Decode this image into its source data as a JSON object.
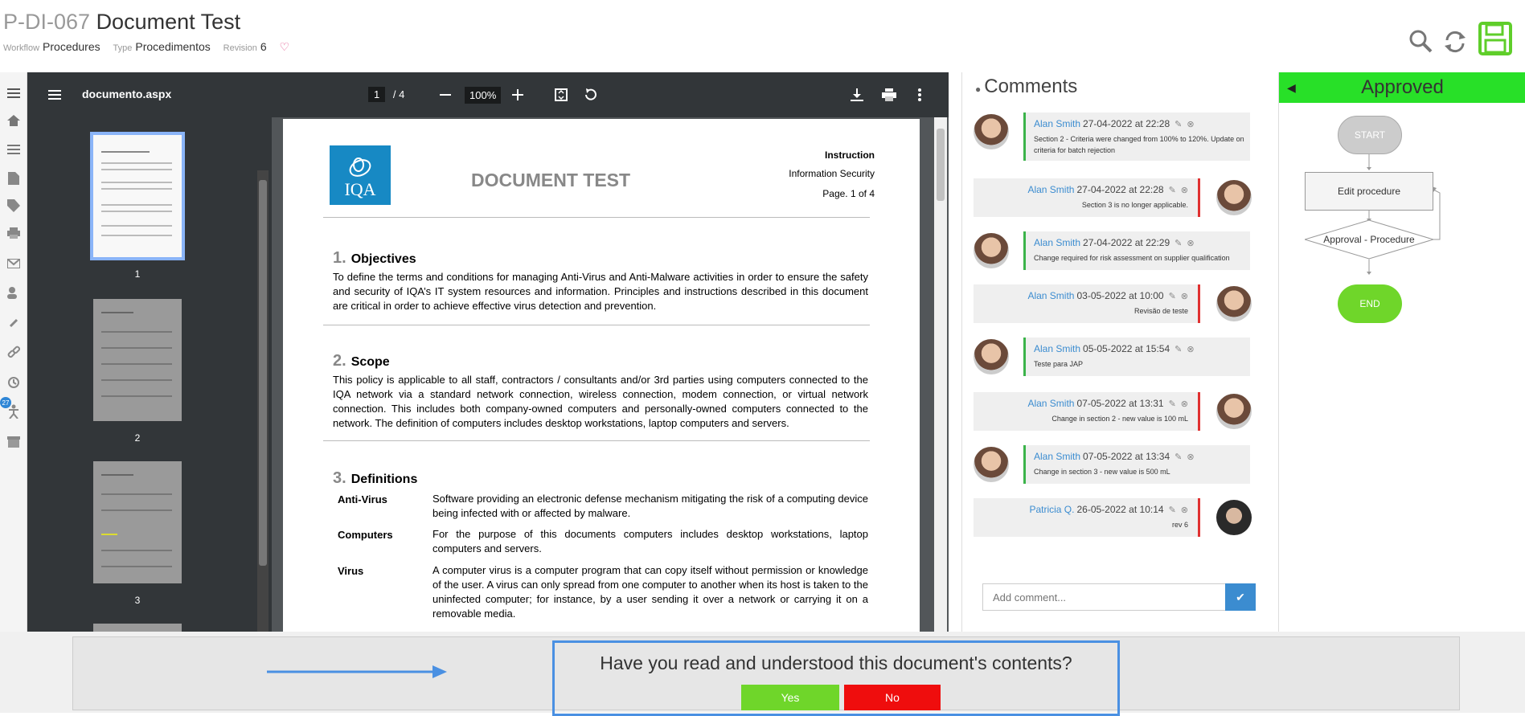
{
  "header": {
    "code": "P-DI-067",
    "title": "Document Test",
    "workflow_label": "Workflow",
    "workflow_value": "Procedures",
    "type_label": "Type",
    "type_value": "Procedimentos",
    "revision_label": "Revision",
    "revision_value": "6",
    "icons": [
      "search-icon",
      "refresh-icon",
      "save-icon"
    ]
  },
  "sidebar": {
    "icons": [
      "menu-icon",
      "home-icon",
      "list-icon",
      "document-icon",
      "tag-icon",
      "print-icon",
      "mail-icon",
      "users-icon",
      "attachment-icon",
      "link-icon",
      "clock-icon",
      "training-icon",
      "archive-icon"
    ],
    "badge": "27"
  },
  "pdf": {
    "filename": "documento.aspx",
    "current_page": "1",
    "total_pages": "/ 4",
    "zoom": "100%",
    "thumbnails": [
      "1",
      "2",
      "3"
    ],
    "document": {
      "logo_text": "IQA",
      "title": "DOCUMENT TEST",
      "right_1": "Instruction",
      "right_2": "Information Security",
      "page_label": "Page. 1 of 4",
      "sections": [
        {
          "num": "1.",
          "title": "Objectives",
          "text": "To define the terms and conditions for managing Anti-Virus and Anti-Malware activities in order to ensure the safety and security of IQA’s IT system resources and information. Principles and instructions described in this document are critical in order to achieve effective virus detection and prevention."
        },
        {
          "num": "2.",
          "title": "Scope",
          "text": "This policy is applicable to all staff, contractors / consultants and/or 3rd parties using computers connected to the IQA network via a standard network connection, wireless connection, modem connection, or virtual network connection. This includes both company-owned computers and personally-owned computers connected to the network. The definition of computers includes desktop workstations, laptop computers and servers."
        },
        {
          "num": "3.",
          "title": "Definitions"
        }
      ],
      "definitions": [
        {
          "term": "Anti-Virus",
          "text": "Software providing an electronic defense mechanism mitigating the risk of a computing device being infected with or affected by malware."
        },
        {
          "term": "Computers",
          "text": "For the purpose of this documents computers includes desktop workstations, laptop computers and servers."
        },
        {
          "term": "Virus",
          "text": "A computer virus is a computer program that can copy itself without permission or knowledge of the user. A virus can only spread from one computer to another when its host is taken to the uninfected computer; for instance, by a user sending it over a network or carrying it on a removable media."
        }
      ]
    }
  },
  "comments": {
    "title": "Comments",
    "items": [
      {
        "side": "left",
        "author": "Alan Smith",
        "date": "27-04-2022 at 22:28",
        "text": "Section 2 - Criteria were changed from 100% to 120%. Update on criteria for batch rejection"
      },
      {
        "side": "right",
        "author": "Alan Smith",
        "date": "27-04-2022 at 22:28",
        "text": "Section 3 is no longer applicable."
      },
      {
        "side": "left",
        "author": "Alan Smith",
        "date": "27-04-2022 at 22:29",
        "text": "Change required for risk assessment on supplier qualification"
      },
      {
        "side": "right",
        "author": "Alan Smith",
        "date": "03-05-2022 at 10:00",
        "text": "Revisão de teste"
      },
      {
        "side": "left",
        "author": "Alan Smith",
        "date": "05-05-2022 at 15:54",
        "text": "Teste para JAP"
      },
      {
        "side": "right",
        "author": "Alan Smith",
        "date": "07-05-2022 at 13:31",
        "text": "Change in section 2 - new value is 100 mL"
      },
      {
        "side": "left",
        "author": "Alan Smith",
        "date": "07-05-2022 at 13:34",
        "text": "Change in section 3 - new value is 500 mL"
      },
      {
        "side": "right",
        "author": "Patricia Q.",
        "date": "26-05-2022 at 10:14",
        "text": "rev 6"
      }
    ],
    "add_placeholder": "Add comment..."
  },
  "workflow": {
    "status": "Approved",
    "status_color": "#28e028",
    "nodes": {
      "start": "START",
      "edit": "Edit procedure",
      "approval": "Approval - Procedure",
      "end": "END"
    }
  },
  "confirm": {
    "question": "Have you read and understood this document's contents?",
    "yes": "Yes",
    "no": "No"
  }
}
